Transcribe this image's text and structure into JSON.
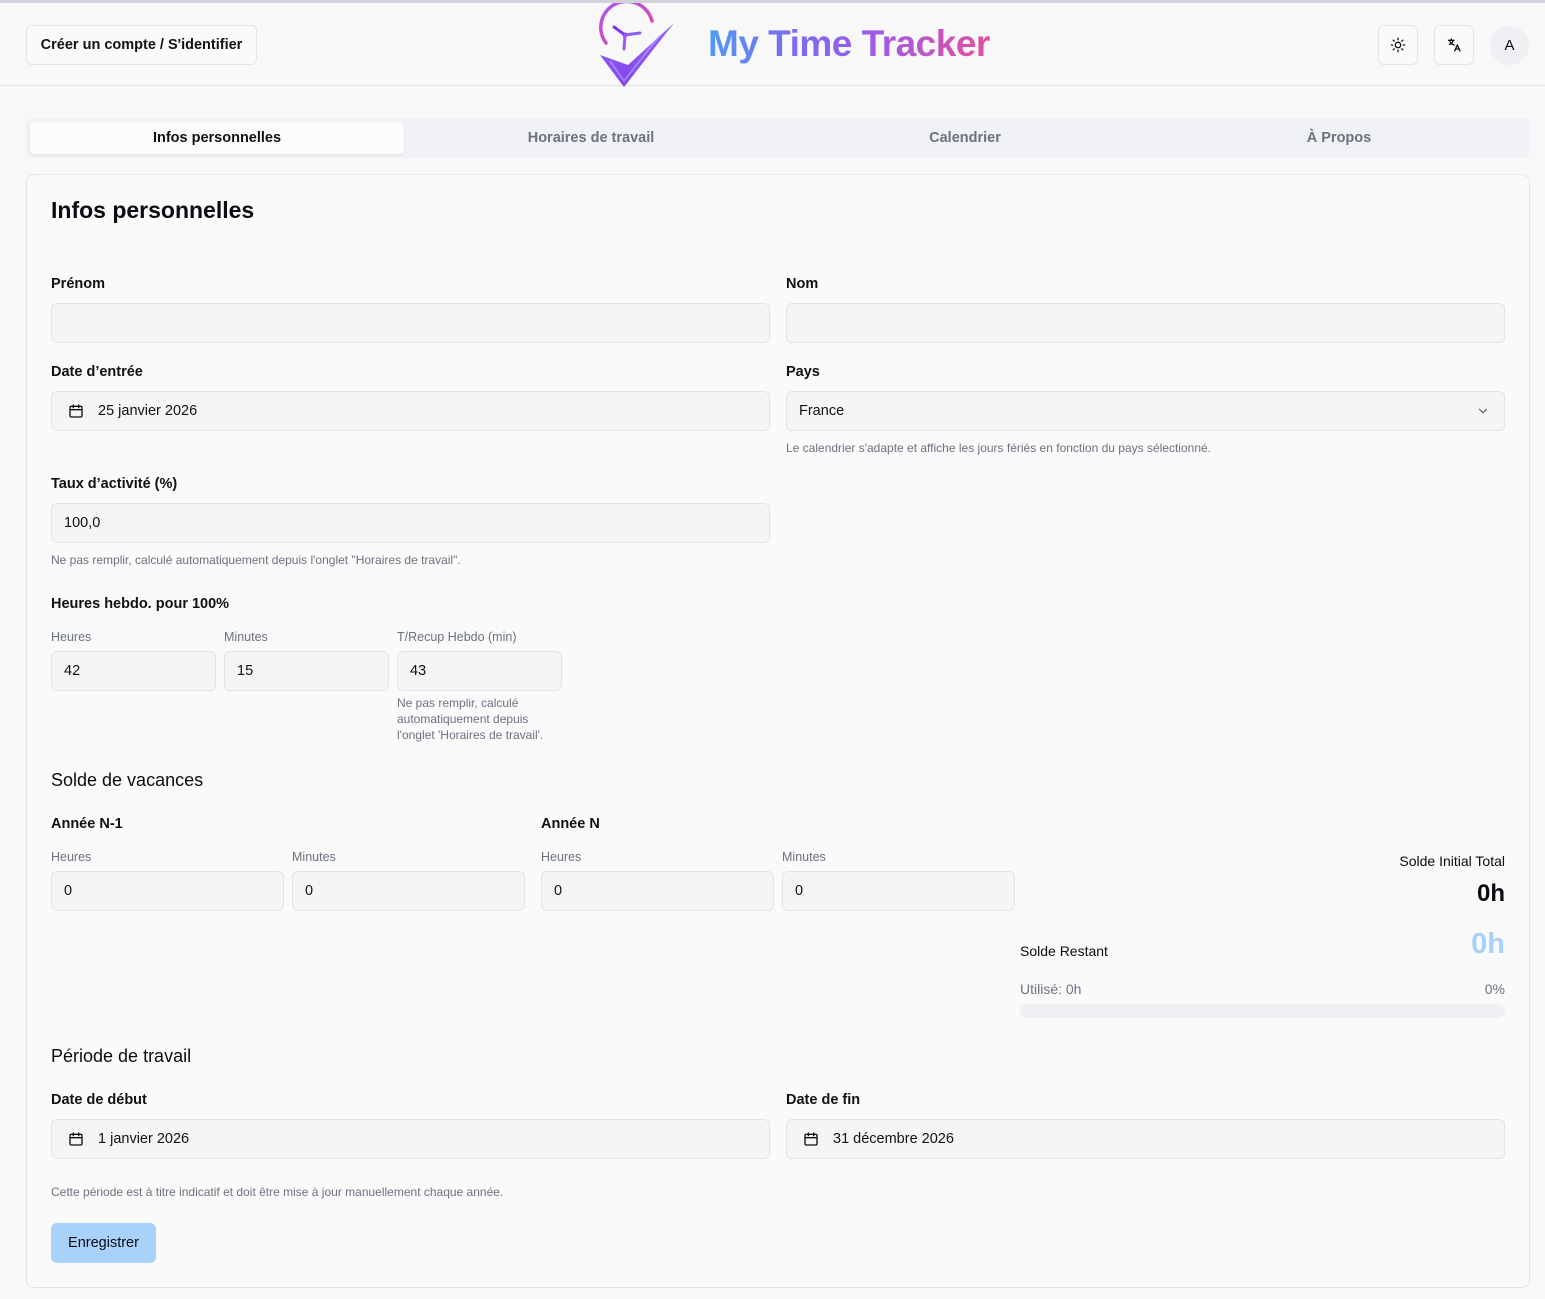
{
  "header": {
    "auth_label": "Créer un compte / S'identifier",
    "brand": "My Time Tracker",
    "avatar_letter": "A"
  },
  "tabs": [
    {
      "label": "Infos personnelles",
      "active": true
    },
    {
      "label": "Horaires de travail",
      "active": false
    },
    {
      "label": "Calendrier",
      "active": false
    },
    {
      "label": "À Propos",
      "active": false
    }
  ],
  "personal": {
    "title": "Infos personnelles",
    "firstname_label": "Prénom",
    "firstname_value": "",
    "lastname_label": "Nom",
    "lastname_value": "",
    "entry_date_label": "Date d’entrée",
    "entry_date_value": "25 janvier 2026",
    "country_label": "Pays",
    "country_value": "France",
    "country_hint": "Le calendrier s'adapte et affiche les jours fériés en fonction du pays sélectionné.",
    "activity_label": "Taux d’activité (%)",
    "activity_value": "100,0",
    "activity_hint": "Ne pas remplir, calculé automatiquement depuis l'onglet \"Horaires de travail\".",
    "weekly_label": "Heures hebdo. pour 100%",
    "hours_label": "Heures",
    "hours_value": "42",
    "minutes_label": "Minutes",
    "minutes_value": "15",
    "recup_label": "T/Recup Hebdo (min)",
    "recup_value": "43",
    "recup_hint_1": "Ne pas remplir, calculé",
    "recup_hint_2": "automatiquement depuis",
    "recup_hint_3": "l'onglet 'Horaires de travail'."
  },
  "vacation": {
    "title": "Solde de vacances",
    "prev_year_label": "Année N-1",
    "year_label": "Année N",
    "hours_label": "Heures",
    "minutes_label": "Minutes",
    "prev_hours": "0",
    "prev_minutes": "0",
    "cur_hours": "0",
    "cur_minutes": "0",
    "initial_total_label": "Solde Initial Total",
    "initial_total_value": "0h",
    "remaining_label": "Solde Restant",
    "remaining_value": "0h",
    "used_label": "Utilisé: 0h",
    "used_percent": "0%",
    "used_fraction": 0
  },
  "period": {
    "title": "Période de travail",
    "start_label": "Date de début",
    "start_value": "1 janvier 2026",
    "end_label": "Date de fin",
    "end_value": "31 décembre 2026",
    "hint": "Cette période est à titre indicatif et doit être mise à jour manuellement chaque année."
  },
  "save_label": "Enregistrer",
  "colors": {
    "accent_light": "#a8d1fb",
    "remaining_value": "#a8d1fb",
    "brand_start": "#4f9cf4",
    "brand_end": "#e4509b"
  },
  "icons": [
    "sun-icon",
    "translate-icon",
    "calendar-icon",
    "chevron-down-icon",
    "logo-clock-check-icon"
  ]
}
